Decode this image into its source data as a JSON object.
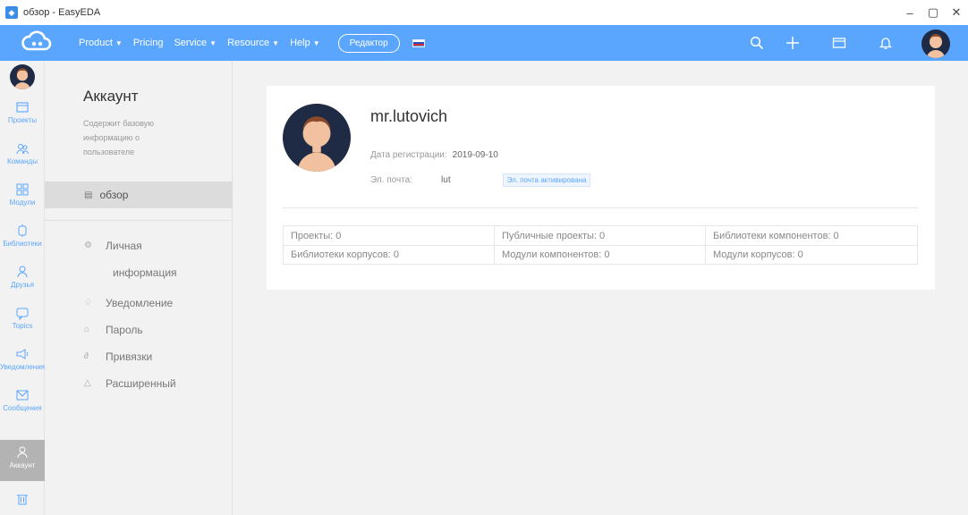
{
  "window": {
    "title": "обзор - EasyEDA"
  },
  "colors": {
    "accent": "#5aa6ff",
    "nav_bg": "#5aa6ff",
    "active_rail": "#b3b3b3"
  },
  "topnav": {
    "menu": [
      {
        "label": "Product",
        "has_caret": true
      },
      {
        "label": "Pricing",
        "has_caret": false
      },
      {
        "label": "Service",
        "has_caret": true
      },
      {
        "label": "Resource",
        "has_caret": true
      },
      {
        "label": "Help",
        "has_caret": true
      }
    ],
    "editor_button": "Редактор",
    "right_icons": [
      "search-icon",
      "plus-icon",
      "folder-icon",
      "bell-icon"
    ]
  },
  "rail": {
    "items": [
      {
        "label": "Проекты",
        "icon": "folder-icon"
      },
      {
        "label": "Команды",
        "icon": "team-icon"
      },
      {
        "label": "Модули",
        "icon": "modules-icon"
      },
      {
        "label": "Библиотеки",
        "icon": "library-icon"
      },
      {
        "label": "Друзья",
        "icon": "friends-icon"
      },
      {
        "label": "Topics",
        "icon": "topics-icon"
      },
      {
        "label": "Уведомления",
        "icon": "megaphone-icon"
      },
      {
        "label": "Сообщения",
        "icon": "mail-icon"
      },
      {
        "label": "Аккаунт",
        "icon": "user-icon",
        "active": true
      },
      {
        "label": "",
        "icon": "trash-icon"
      }
    ]
  },
  "sidebar": {
    "title": "Аккаунт",
    "description": "Содержит базовую информацию о пользователе",
    "active_item": "обзор",
    "items": [
      {
        "label_line1": "Личная",
        "label_line2": "информация",
        "icon": "settings-icon"
      },
      {
        "label_line1": "Уведомление",
        "icon": "bell-icon"
      },
      {
        "label_line1": "Пароль",
        "icon": "lock-icon"
      },
      {
        "label_line1": "Привязки",
        "icon": "link-icon"
      },
      {
        "label_line1": "Расширенный",
        "icon": "warning-icon"
      }
    ]
  },
  "profile": {
    "username": "mr.lutovich",
    "reg_label": "Дата регистрации:",
    "reg_date": "2019-09-10",
    "email_label": "Эл. почта:",
    "email_value": "lut",
    "email_badge": "Эл. почта активирована"
  },
  "stats": [
    [
      "Проекты: 0",
      "Публичные проекты: 0",
      "Библиотеки компонентов: 0"
    ],
    [
      "Библиотеки корпусов: 0",
      "Модули компонентов: 0",
      "Модули корпусов: 0"
    ]
  ]
}
